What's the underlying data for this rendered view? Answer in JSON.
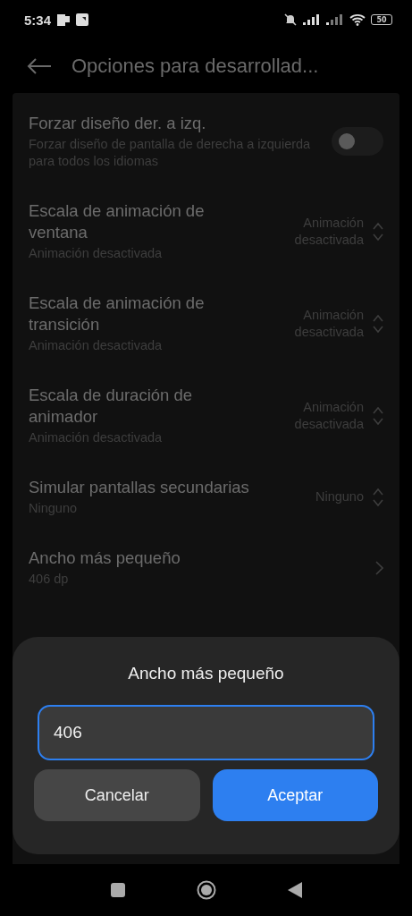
{
  "status_bar": {
    "time": "5:34",
    "battery": "50"
  },
  "header": {
    "title": "Opciones para desarrollad..."
  },
  "settings": [
    {
      "kind": "toggle",
      "title": "Forzar diseño der. a izq.",
      "summary": "Forzar diseño de pantalla de derecha a izquierda para todos los idiomas",
      "on": false
    },
    {
      "kind": "spinner",
      "title": "Escala de animación de ventana",
      "summary": "Animación desactivada",
      "value": "Animación desactivada"
    },
    {
      "kind": "spinner",
      "title": "Escala de animación de transición",
      "summary": "Animación desactivada",
      "value": "Animación desactivada"
    },
    {
      "kind": "spinner",
      "title": "Escala de duración de animador",
      "summary": "Animación desactivada",
      "value": "Animación desactivada"
    },
    {
      "kind": "spinner",
      "title": "Simular pantallas secundarias",
      "summary": "Ninguno",
      "value": "Ninguno"
    },
    {
      "kind": "link",
      "title": "Ancho más pequeño",
      "summary": "406 dp"
    }
  ],
  "dialog": {
    "title": "Ancho más pequeño",
    "value": "406",
    "buttons": [
      {
        "label": "Cancelar",
        "kind": "secondary"
      },
      {
        "label": "Aceptar",
        "kind": "primary"
      }
    ]
  }
}
